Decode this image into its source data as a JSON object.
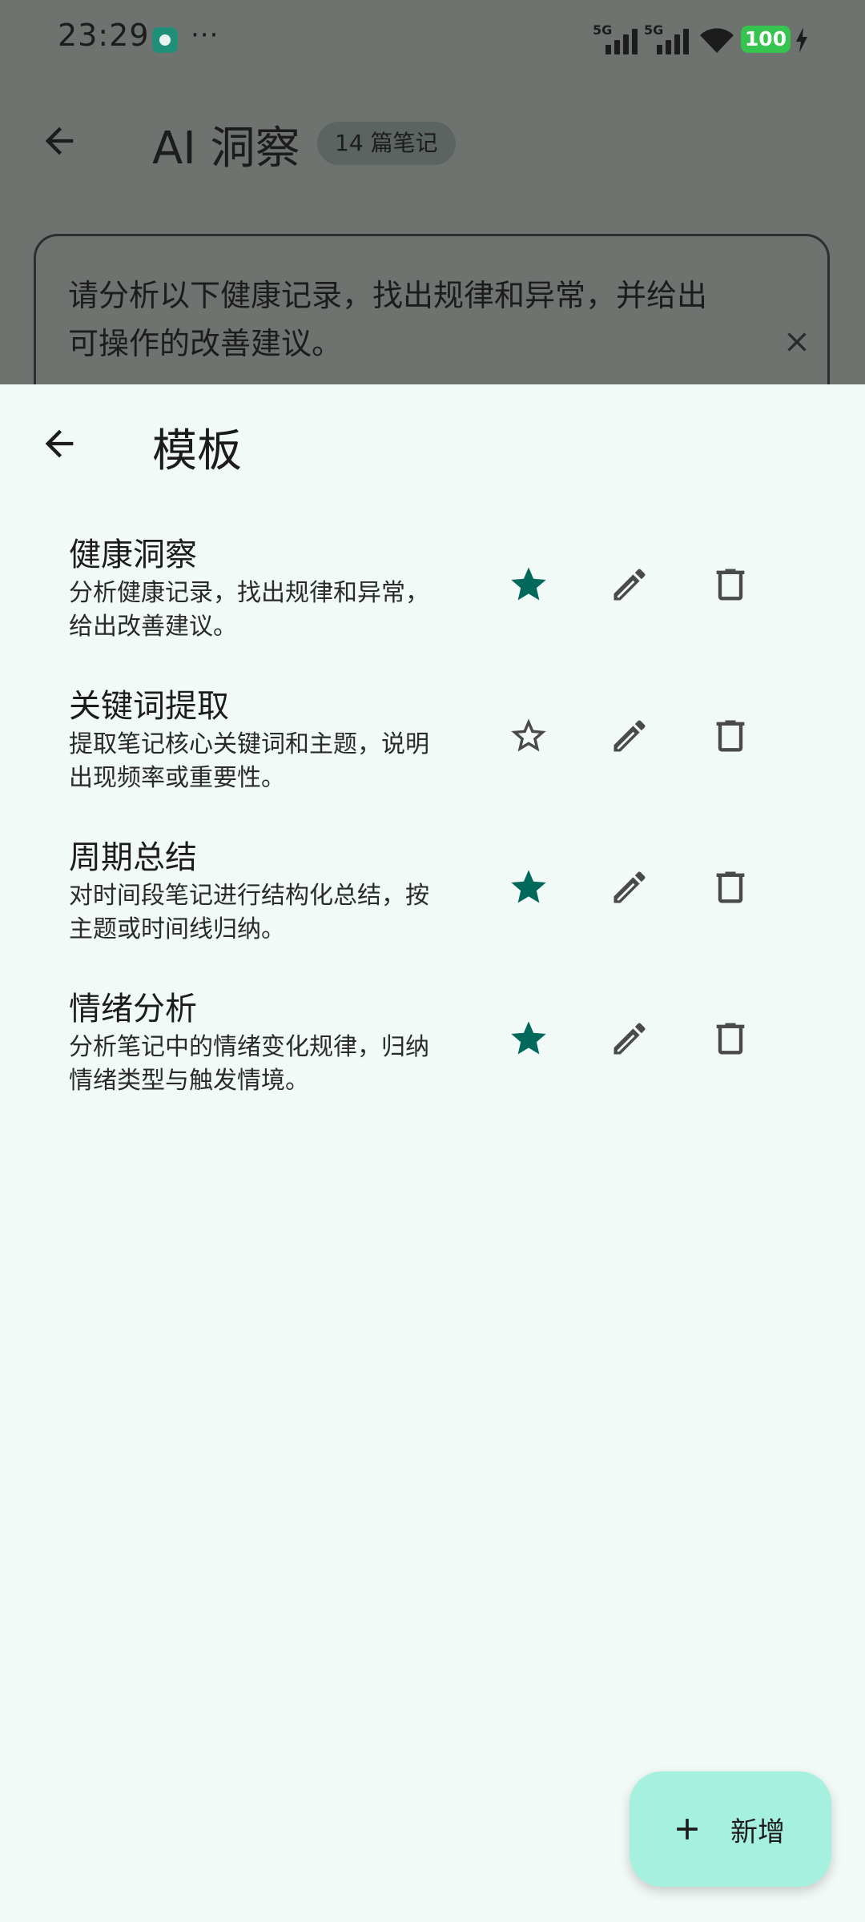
{
  "status_bar": {
    "time": "23:29",
    "overflow_dots": "···",
    "network_1": "5G",
    "network_2": "5G",
    "battery_level": "100"
  },
  "background_page": {
    "title": "AI 洞察",
    "note_count_badge": "14 篇笔记",
    "prompt_text": "请分析以下健康记录，找出规律和异常，并给出可操作的改善建议。"
  },
  "sheet": {
    "title": "模板",
    "templates": [
      {
        "name": "健康洞察",
        "description": "分析健康记录，找出规律和异常，给出改善建议。",
        "starred": true
      },
      {
        "name": "关键词提取",
        "description": "提取笔记核心关键词和主题，说明出现频率或重要性。",
        "starred": false
      },
      {
        "name": "周期总结",
        "description": "对时间段笔记进行结构化总结，按主题或时间线归纳。",
        "starred": true
      },
      {
        "name": "情绪分析",
        "description": "分析笔记中的情绪变化规律，归纳情绪类型与触发情境。",
        "starred": true
      }
    ]
  },
  "fab": {
    "label": "新增"
  },
  "colors": {
    "accent": "#00695c",
    "icon_gray": "#4a4a4a",
    "sheet_bg": "#f2faf7",
    "fab_bg": "#a6f0e0",
    "scrim": "#6f7370"
  }
}
